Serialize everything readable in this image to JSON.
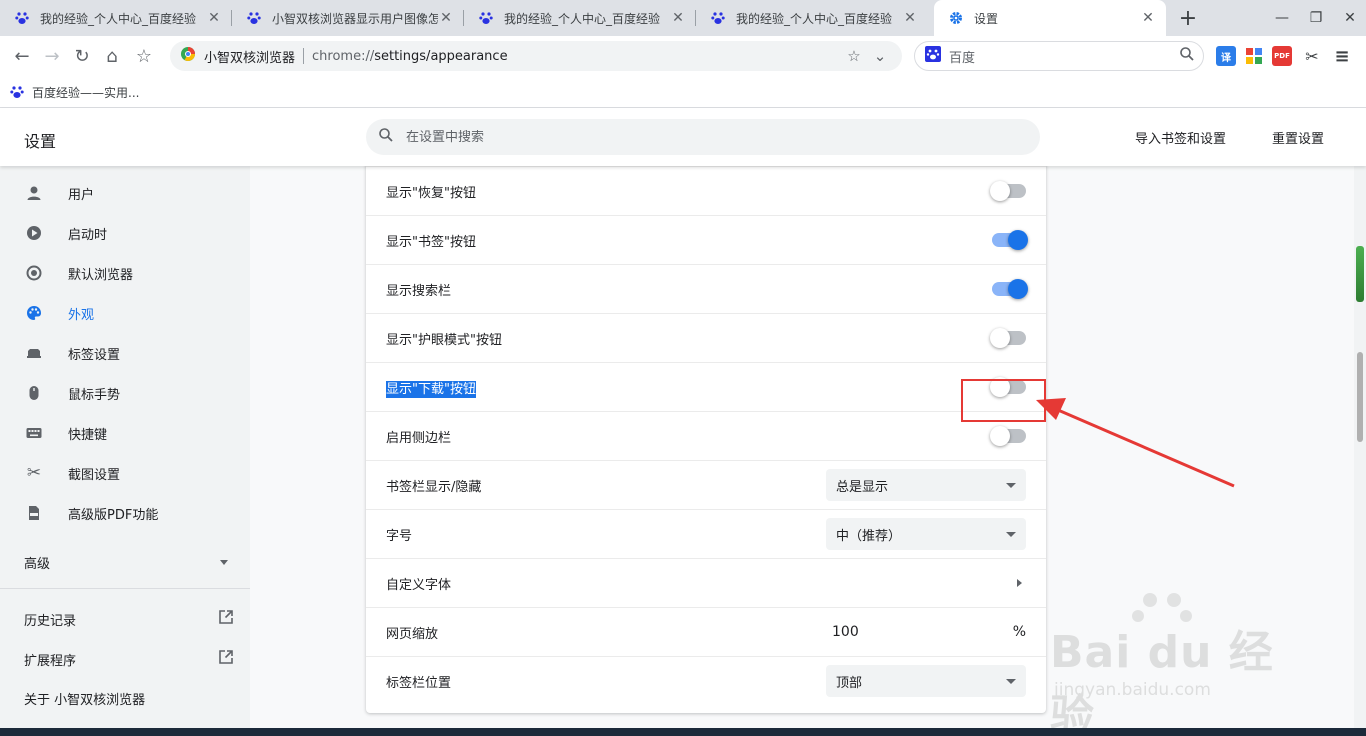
{
  "tabs": [
    {
      "title": "我的经验_个人中心_百度经验",
      "active": false
    },
    {
      "title": "小智双核浏览器显示用户图像怎",
      "active": false
    },
    {
      "title": "我的经验_个人中心_百度经验",
      "active": false
    },
    {
      "title": "我的经验_个人中心_百度经验",
      "active": false
    },
    {
      "title": "设置",
      "active": true
    }
  ],
  "toolbar": {
    "brand": "小智双核浏览器",
    "url_scheme": "chrome://",
    "url_path": "settings/appearance",
    "search_engine": "百度",
    "ext_pdf": "PDF",
    "ext_translate": "译"
  },
  "bookmarks": [
    {
      "label": "百度经验——实用..."
    }
  ],
  "header": {
    "title": "设置",
    "search_placeholder": "在设置中搜索",
    "import_label": "导入书签和设置",
    "reset_label": "重置设置"
  },
  "sidebar": {
    "items": [
      {
        "label": "用户",
        "icon": "person-icon"
      },
      {
        "label": "启动时",
        "icon": "power-icon"
      },
      {
        "label": "默认浏览器",
        "icon": "browser-icon"
      },
      {
        "label": "外观",
        "icon": "palette-icon",
        "active": true
      },
      {
        "label": "标签设置",
        "icon": "tab-icon"
      },
      {
        "label": "鼠标手势",
        "icon": "mouse-icon"
      },
      {
        "label": "快捷键",
        "icon": "keyboard-icon"
      },
      {
        "label": "截图设置",
        "icon": "scissors-icon"
      },
      {
        "label": "高级版PDF功能",
        "icon": "pdf-icon"
      }
    ],
    "advanced": "高级",
    "history": "历史记录",
    "extensions": "扩展程序",
    "about": "关于 小智双核浏览器"
  },
  "settings_rows": [
    {
      "label": "显示\"恢复\"按钮",
      "control": "toggle",
      "on": false
    },
    {
      "label": "显示\"书签\"按钮",
      "control": "toggle",
      "on": true
    },
    {
      "label": "显示搜索栏",
      "control": "toggle",
      "on": true
    },
    {
      "label": "显示\"护眼模式\"按钮",
      "control": "toggle",
      "on": false
    },
    {
      "label": "显示\"下载\"按钮",
      "control": "toggle",
      "on": false,
      "selected": true
    },
    {
      "label": "启用侧边栏",
      "control": "toggle",
      "on": false
    },
    {
      "label": "书签栏显示/隐藏",
      "control": "select",
      "value": "总是显示"
    },
    {
      "label": "字号",
      "control": "select",
      "value": "中（推荐）"
    },
    {
      "label": "自定义字体",
      "control": "link"
    },
    {
      "label": "网页缩放",
      "control": "zoom",
      "value": "100",
      "unit": "%"
    },
    {
      "label": "标签栏位置",
      "control": "select",
      "value": "顶部"
    }
  ],
  "watermark": {
    "logo": "Bai du 经验",
    "sub": "jingyan.baidu.com"
  },
  "colors": {
    "accent": "#1a73e8",
    "annotation": "#e53935",
    "toggle_off": "#bdc1c6"
  }
}
